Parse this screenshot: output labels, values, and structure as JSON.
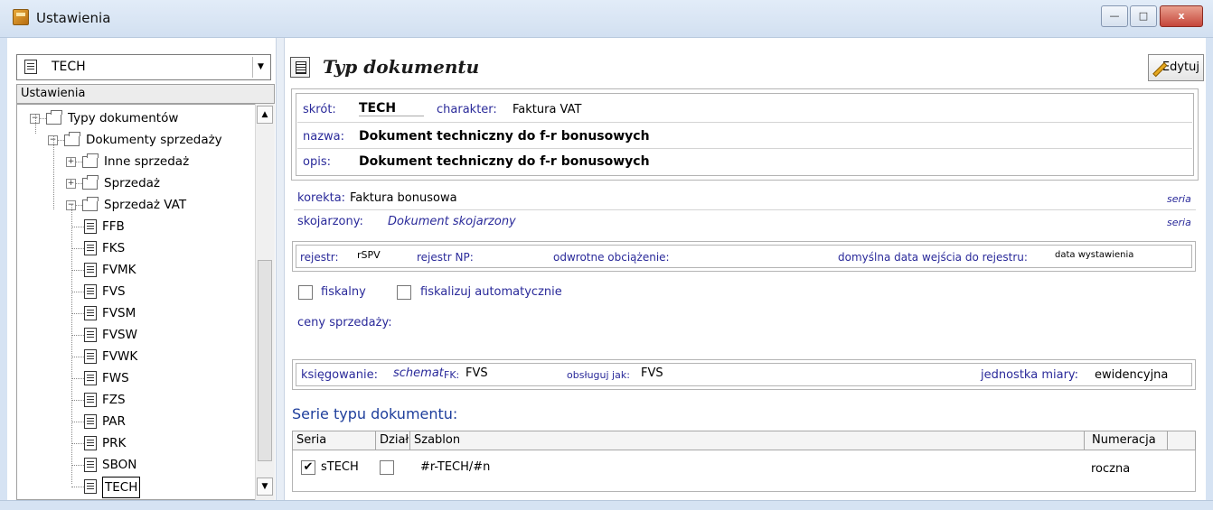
{
  "window": {
    "title": "Ustawienia",
    "controls": {
      "minimize": "—",
      "maximize": "□",
      "close": "x"
    }
  },
  "left": {
    "combo_value": "TECH",
    "header": "Ustawienia",
    "tree": [
      {
        "label": "Typy dokumentów",
        "kind": "folder",
        "level": 0,
        "expanded": true
      },
      {
        "label": "Dokumenty sprzedaży",
        "kind": "folder",
        "level": 1,
        "expanded": true
      },
      {
        "label": "Inne sprzedaż",
        "kind": "folder",
        "level": 2,
        "expanded": false
      },
      {
        "label": "Sprzedaż",
        "kind": "folder",
        "level": 2,
        "expanded": false
      },
      {
        "label": "Sprzedaż VAT",
        "kind": "folder",
        "level": 2,
        "expanded": true
      },
      {
        "label": "FFB",
        "kind": "doc",
        "level": 3
      },
      {
        "label": "FKS",
        "kind": "doc",
        "level": 3
      },
      {
        "label": "FVMK",
        "kind": "doc",
        "level": 3
      },
      {
        "label": "FVS",
        "kind": "doc",
        "level": 3
      },
      {
        "label": "FVSM",
        "kind": "doc",
        "level": 3
      },
      {
        "label": "FVSW",
        "kind": "doc",
        "level": 3
      },
      {
        "label": "FVWK",
        "kind": "doc",
        "level": 3
      },
      {
        "label": "FWS",
        "kind": "doc",
        "level": 3
      },
      {
        "label": "FZS",
        "kind": "doc",
        "level": 3
      },
      {
        "label": "PAR",
        "kind": "doc",
        "level": 3
      },
      {
        "label": "PRK",
        "kind": "doc",
        "level": 3
      },
      {
        "label": "SBON",
        "kind": "doc",
        "level": 3
      },
      {
        "label": "TECH",
        "kind": "doc",
        "level": 3,
        "selected": true
      }
    ]
  },
  "right": {
    "title": "Typ dokumentu",
    "edit_label": "Edytuj",
    "skrot_label": "skrót:",
    "skrot_value": "TECH",
    "charakter_label": "charakter:",
    "charakter_value": "Faktura VAT",
    "nazwa_label": "nazwa:",
    "nazwa_value": "Dokument techniczny do f-r bonusowych",
    "opis_label": "opis:",
    "opis_value": "Dokument techniczny do f-r bonusowych",
    "korekta_label": "korekta:",
    "korekta_value": "Faktura bonusowa",
    "seria1": "seria",
    "skojarzony_label": "skojarzony:",
    "skojarzony_value": "Dokument skojarzony",
    "seria2": "seria",
    "rejestr_label": "rejestr:",
    "rejestr_value": "rSPV",
    "rejestr_np_label": "rejestr NP:",
    "odwrotne_label": "odwrotne obciążenie:",
    "data_wejscia_label": "domyślna data wejścia do rejestru:",
    "data_wejscia_value": "data wystawienia",
    "fiskalny_label": "fiskalny",
    "fiskalizuj_label": "fiskalizuj automatycznie",
    "ceny_label": "ceny sprzedaży:",
    "ksiegowanie_label": "księgowanie:",
    "schemat_label": "schemat",
    "fk_label": "FK:",
    "fk_value": "FVS",
    "obsluguj_label": "obsługuj jak:",
    "obsluguj_value": "FVS",
    "jednostka_label": "jednostka miary:",
    "jednostka_value": "ewidencyjna",
    "serie_title": "Serie typu dokumentu:",
    "grid_headers": {
      "seria": "Seria",
      "dzial": "Dział",
      "szablon": "Szablon",
      "numeracja": "Numeracja"
    },
    "grid_rows": [
      {
        "checked": true,
        "seria": "sTECH",
        "dzial_checked": false,
        "szablon": "#r-TECH/#n",
        "numeracja": "roczna"
      }
    ]
  }
}
